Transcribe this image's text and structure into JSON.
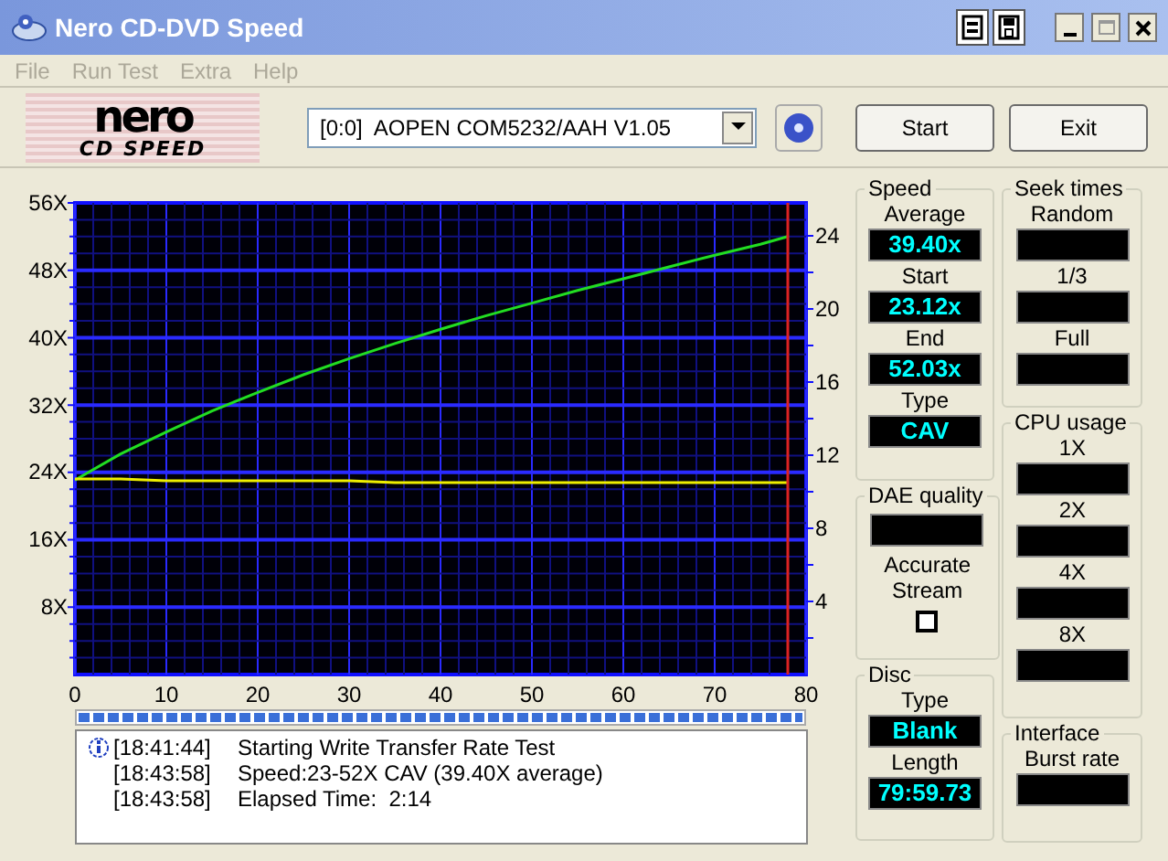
{
  "window": {
    "title": "Nero CD-DVD Speed"
  },
  "menu": [
    {
      "label": "File",
      "disabled": true
    },
    {
      "label": "Run Test",
      "disabled": true
    },
    {
      "label": "Extra",
      "disabled": true
    },
    {
      "label": "Help",
      "disabled": true
    }
  ],
  "logo": {
    "line_1": "nero",
    "line_2": "CD SPEED"
  },
  "drive_select": {
    "value": "[0:0]  AOPEN COM5232/AAH V1.05"
  },
  "buttons": [
    "Start",
    "Exit"
  ],
  "chart": {
    "chart_data": {
      "type": "line",
      "x": [
        0,
        5,
        10,
        15,
        20,
        25,
        30,
        35,
        40,
        45,
        50,
        55,
        60,
        65,
        70,
        75,
        78
      ],
      "xlim": [
        0,
        80
      ],
      "ylim": [
        0,
        56
      ],
      "xticks": [
        0,
        10,
        20,
        30,
        40,
        50,
        60,
        70,
        80
      ],
      "yticks": [
        {
          "value": 8,
          "label": "8X"
        },
        {
          "value": 16,
          "label": "16X"
        },
        {
          "value": 24,
          "label": "24X"
        },
        {
          "value": 32,
          "label": "32X"
        },
        {
          "value": 40,
          "label": "40X"
        },
        {
          "value": 48,
          "label": "48X"
        },
        {
          "value": 56,
          "label": "56X"
        }
      ],
      "y2ticks": [
        {
          "value": 4,
          "label": "4"
        },
        {
          "value": 8,
          "label": "8"
        },
        {
          "value": 12,
          "label": "12"
        },
        {
          "value": 16,
          "label": "16"
        },
        {
          "value": 20,
          "label": "20"
        },
        {
          "value": 24,
          "label": "24"
        }
      ],
      "y2lim": [
        0,
        25.8
      ],
      "grid": true,
      "ref_lines": [
        {
          "axis": "x",
          "value": 78,
          "color": "#dd2222"
        }
      ],
      "series": [
        {
          "color": "#22dd22",
          "values": [
            23.1,
            26.2,
            28.8,
            31.3,
            33.5,
            35.6,
            37.5,
            39.3,
            41.0,
            42.6,
            44.1,
            45.6,
            47.0,
            48.4,
            49.8,
            51.1,
            52.0
          ]
        },
        {
          "color": "#eeee00",
          "axis": "y2",
          "values": [
            10.7,
            10.7,
            10.6,
            10.6,
            10.6,
            10.6,
            10.6,
            10.5,
            10.5,
            10.5,
            10.5,
            10.5,
            10.5,
            10.5,
            10.5,
            10.5,
            10.5
          ]
        }
      ]
    }
  },
  "progress": {
    "level": 1
  },
  "log": [
    {
      "kind": "info",
      "time": "[18:41:44]",
      "message": "Starting Write Transfer Rate Test"
    },
    {
      "kind": "plain",
      "time": "[18:43:58]",
      "message": "Speed:23-52X CAV (39.40X average)"
    },
    {
      "kind": "plain",
      "time": "[18:43:58]",
      "message": "Elapsed Time:  2:14"
    }
  ],
  "speed": {
    "title": "Speed",
    "fields": [
      {
        "label": "Average",
        "value": "39.40x"
      },
      {
        "label": "Start",
        "value": "23.12x"
      },
      {
        "label": "End",
        "value": "52.03x"
      },
      {
        "label": "Type",
        "value": "CAV"
      }
    ]
  },
  "dae_quality": {
    "title": "DAE quality",
    "accurate_stream_label": "Accurate Stream",
    "accurate_stream_checked": false
  },
  "disc": {
    "title": "Disc",
    "fields": [
      {
        "label": "Type",
        "value": "Blank"
      },
      {
        "label": "Length",
        "value": "79:59.73"
      }
    ]
  },
  "seek_times": {
    "title": "Seek times",
    "fields": [
      {
        "label": "Random"
      },
      {
        "label": "1/3"
      },
      {
        "label": "Full"
      }
    ]
  },
  "cpu_usage": {
    "title": "CPU usage",
    "fields": [
      {
        "label": "1X"
      },
      {
        "label": "2X"
      },
      {
        "label": "4X"
      },
      {
        "label": "8X"
      }
    ]
  },
  "interface": {
    "title": "Interface",
    "fields": [
      {
        "label": "Burst rate"
      }
    ]
  }
}
